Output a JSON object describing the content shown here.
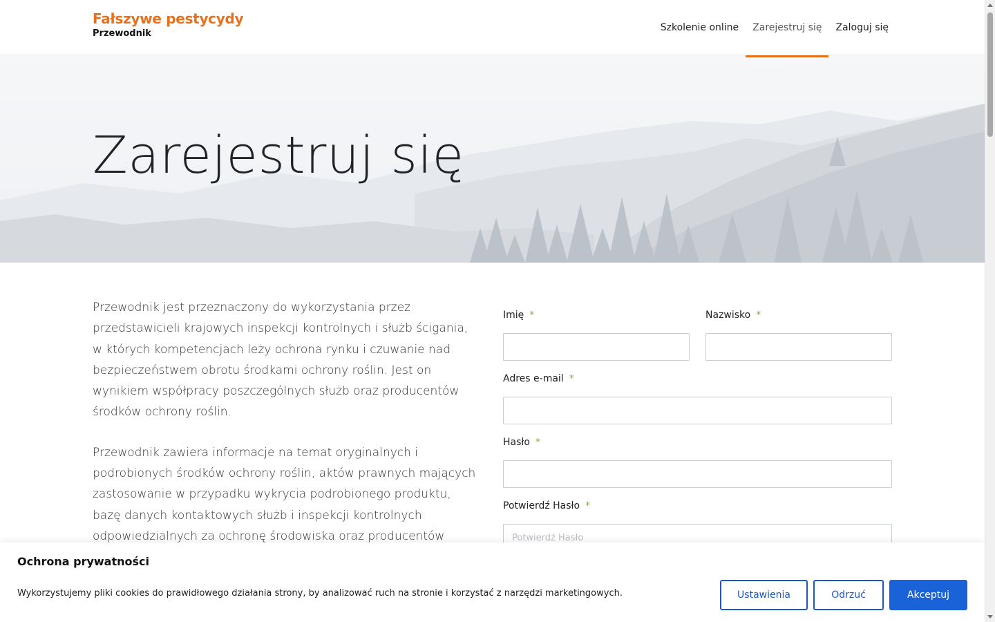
{
  "header": {
    "brand_title": "Fałszywe pestycydy",
    "brand_subtitle": "Przewodnik",
    "nav": [
      {
        "label": "Szkolenie online",
        "active": false
      },
      {
        "label": "Zarejestruj się",
        "active": true
      },
      {
        "label": "Zaloguj się",
        "active": false
      }
    ],
    "accent_color": "#e8711c"
  },
  "hero": {
    "title": "Zarejestruj się"
  },
  "content": {
    "paragraph_1": "Przewodnik jest przeznaczony do wykorzystania przez przedstawicieli krajowych inspekcji kontrolnych i służb ścigania, w których kompetencjach leży ochrona rynku i czuwanie nad bezpieczeństwem obrotu środkami ochrony roślin. Jest on wynikiem współpracy poszczególnych służb oraz producentów środków ochrony roślin.",
    "paragraph_2": "Przewodnik zawiera informacje na temat oryginalnych i podrobionych środków ochrony roślin, aktów prawnych mających zastosowanie w przypadku wykrycia podrobionego produktu, bazę danych kontaktowych służb i inspekcji kontrolnych odpowiedzialnych za ochronę środowiska oraz producentów"
  },
  "form": {
    "first_name_label": "Imię",
    "last_name_label": "Nazwisko",
    "email_label": "Adres e-mail",
    "password_label": "Hasło",
    "confirm_password_label": "Potwierdź Hasło",
    "confirm_password_placeholder": "Potwierdź Hasło",
    "required_marker": "*",
    "required_color": "#7cb342"
  },
  "cookie": {
    "title": "Ochrona prywatności",
    "text": "Wykorzystujemy pliki cookies do prawidłowego działania strony, by analizować ruch na stronie i korzystać z narzędzi marketingowych.",
    "settings_label": "Ustawienia",
    "reject_label": "Odrzuć",
    "accept_label": "Akceptuj",
    "button_color": "#1a62d8"
  }
}
